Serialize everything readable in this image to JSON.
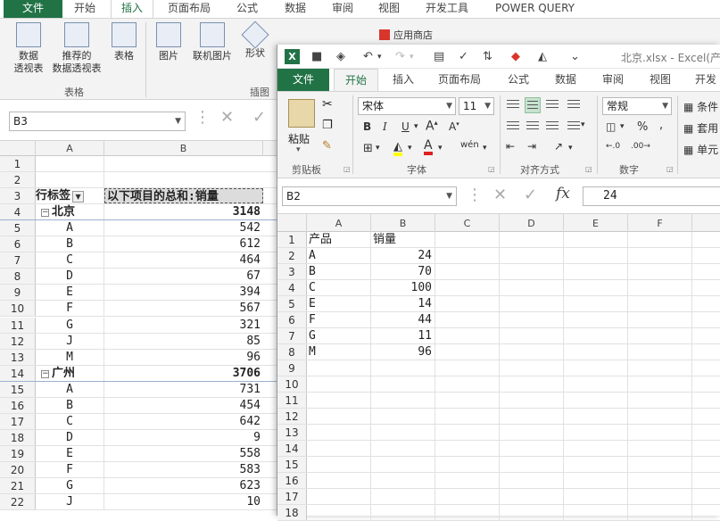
{
  "back_window": {
    "tabs": [
      "文件",
      "开始",
      "插入",
      "页面布局",
      "公式",
      "数据",
      "审阅",
      "视图",
      "开发工具",
      "POWER QUERY"
    ],
    "active_tab": "插入",
    "ribbon": {
      "pivot_button": "数据\n透视表",
      "recommended_pivot_button": "推荐的\n数据透视表",
      "table_button": "表格",
      "group_tables": "表格",
      "picture_button": "图片",
      "online_picture_button": "联机图片",
      "shapes_button": "形状",
      "group_illustrations": "插图",
      "store_button": "应用商店"
    },
    "name_box": "B3",
    "columns": [
      "A",
      "B"
    ],
    "pivot_header": {
      "row_label": "行标签",
      "value_label": "以下项目的总和:销量"
    },
    "rows": [
      {
        "n": "1",
        "a": "",
        "b": ""
      },
      {
        "n": "2",
        "a": "",
        "b": ""
      },
      {
        "n": "3",
        "a": "行标签",
        "b": "以下项目的总和:销量",
        "type": "hdr"
      },
      {
        "n": "4",
        "a": "北京",
        "b": "3148",
        "type": "group"
      },
      {
        "n": "5",
        "a": "A",
        "b": "542",
        "type": "item"
      },
      {
        "n": "6",
        "a": "B",
        "b": "612",
        "type": "item"
      },
      {
        "n": "7",
        "a": "C",
        "b": "464",
        "type": "item"
      },
      {
        "n": "8",
        "a": "D",
        "b": "67",
        "type": "item"
      },
      {
        "n": "9",
        "a": "E",
        "b": "394",
        "type": "item"
      },
      {
        "n": "10",
        "a": "F",
        "b": "567",
        "type": "item"
      },
      {
        "n": "11",
        "a": "G",
        "b": "321",
        "type": "item"
      },
      {
        "n": "12",
        "a": "J",
        "b": "85",
        "type": "item"
      },
      {
        "n": "13",
        "a": "M",
        "b": "96",
        "type": "item"
      },
      {
        "n": "14",
        "a": "广州",
        "b": "3706",
        "type": "group"
      },
      {
        "n": "15",
        "a": "A",
        "b": "731",
        "type": "item"
      },
      {
        "n": "16",
        "a": "B",
        "b": "454",
        "type": "item"
      },
      {
        "n": "17",
        "a": "C",
        "b": "642",
        "type": "item"
      },
      {
        "n": "18",
        "a": "D",
        "b": "9",
        "type": "item"
      },
      {
        "n": "19",
        "a": "E",
        "b": "558",
        "type": "item"
      },
      {
        "n": "20",
        "a": "F",
        "b": "583",
        "type": "item"
      },
      {
        "n": "21",
        "a": "G",
        "b": "623",
        "type": "item"
      },
      {
        "n": "22",
        "a": "J",
        "b": "10",
        "type": "item"
      }
    ]
  },
  "front_window": {
    "title": "北京.xlsx - Excel(产品",
    "tabs": [
      "文件",
      "开始",
      "插入",
      "页面布局",
      "公式",
      "数据",
      "审阅",
      "视图",
      "开发"
    ],
    "active_tab": "开始",
    "ribbon": {
      "paste_label": "粘贴",
      "group_clipboard": "剪贴板",
      "font_name": "宋体",
      "font_size": "11",
      "group_font": "字体",
      "group_alignment": "对齐方式",
      "number_format": "常规",
      "group_number": "数字",
      "conditional_format": "条件",
      "table_format": "套用",
      "cell_styles": "单元"
    },
    "name_box": "B2",
    "formula_value": "24",
    "columns": [
      "A",
      "B",
      "C",
      "D",
      "E",
      "F"
    ],
    "rows": [
      {
        "n": "1",
        "a": "产品",
        "b": "销量"
      },
      {
        "n": "2",
        "a": "A",
        "b": "24"
      },
      {
        "n": "3",
        "a": "B",
        "b": "70"
      },
      {
        "n": "4",
        "a": "C",
        "b": "100"
      },
      {
        "n": "5",
        "a": "E",
        "b": "14"
      },
      {
        "n": "6",
        "a": "F",
        "b": "44"
      },
      {
        "n": "7",
        "a": "G",
        "b": "11"
      },
      {
        "n": "8",
        "a": "M",
        "b": "96"
      },
      {
        "n": "9",
        "a": "",
        "b": ""
      },
      {
        "n": "10",
        "a": "",
        "b": ""
      },
      {
        "n": "11",
        "a": "",
        "b": ""
      },
      {
        "n": "12",
        "a": "",
        "b": ""
      },
      {
        "n": "13",
        "a": "",
        "b": ""
      },
      {
        "n": "14",
        "a": "",
        "b": ""
      },
      {
        "n": "15",
        "a": "",
        "b": ""
      },
      {
        "n": "16",
        "a": "",
        "b": ""
      },
      {
        "n": "17",
        "a": "",
        "b": ""
      },
      {
        "n": "18",
        "a": "",
        "b": ""
      }
    ]
  }
}
